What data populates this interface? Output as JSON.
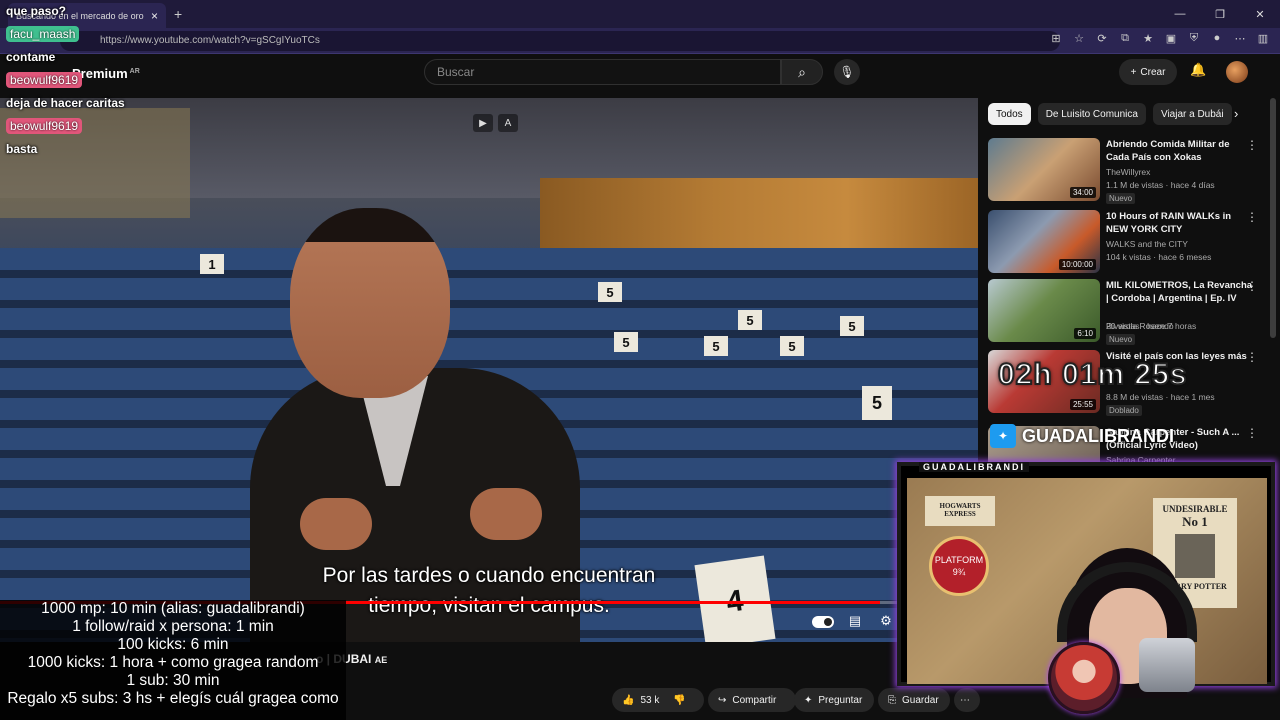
{
  "browser": {
    "tab_title": "Buscando en el mercado de oro",
    "url": "https://www.youtube.com/watch?v=gSCgIYuoTCs"
  },
  "youtube": {
    "logo_text": "Premium",
    "logo_country": "AR",
    "search_placeholder": "Buscar",
    "create_label": "Crear"
  },
  "video": {
    "subtitle_line1": "Por las tardes o cuando encuentran",
    "subtitle_line2": "tiempo, visitan el campus.",
    "title_visible": "o | DUBAI",
    "title_flag": "AE",
    "progress": 0.9,
    "seat_numbers": [
      "1",
      "5",
      "5",
      "5",
      "5",
      "5",
      "5",
      "5",
      "4"
    ]
  },
  "actions": {
    "likes": "53 k",
    "share": "Compartir",
    "ask": "Preguntar",
    "save": "Guardar"
  },
  "chips": [
    "Todos",
    "De Luisito Comunica",
    "Viajar a Dubái"
  ],
  "recommendations": [
    {
      "title": "Abriendo Comida Militar de Cada País con Xokas",
      "channel": "TheWillyrex",
      "meta": "1.1 M de vistas · hace 4 días",
      "duration": "34:00",
      "badge": "Nuevo"
    },
    {
      "title": "10 Hours of RAIN WALKs in NEW YORK CITY",
      "channel": "WALKS and the CITY",
      "meta": "104 k vistas · hace 6 meses",
      "duration": "10:00:00",
      "badge": ""
    },
    {
      "title": "MIL KILOMETROS, La Revancha | Cordoba | Argentina | Ep. IV",
      "channel": "Rivarola Rosendo",
      "meta": "20 vistas · hace 7 horas",
      "duration": "6:10",
      "badge": "Nuevo"
    },
    {
      "title": "Visité el país con las leyes más",
      "channel": "",
      "meta": "8.8 M de vistas · hace 1 mes",
      "duration": "25:55",
      "badge": "Doblado"
    },
    {
      "title": "Sabrina Carpenter - Such A ... (Official Lyric Video)",
      "channel": "Sabrina Carpenter",
      "meta": "",
      "duration": "",
      "badge": ""
    }
  ],
  "chat": [
    {
      "type": "msg",
      "text": "que paso?"
    },
    {
      "type": "nick",
      "text": "facu_maash",
      "color": "#3fbf8f"
    },
    {
      "type": "msg",
      "text": "contame"
    },
    {
      "type": "nick",
      "text": "beowulf9619",
      "color": "#e0567a"
    },
    {
      "type": "msg",
      "text": "deja de hacer caritas"
    },
    {
      "type": "nick",
      "text": "beowulf9619",
      "color": "#e0567a"
    },
    {
      "type": "msg",
      "text": "basta"
    }
  ],
  "stream": {
    "timer": "02h 01m 25s",
    "twitter_handle": "GUADALIBRANDI",
    "cam_label": "GUADALIBRANDI",
    "poster_title": "UNDESIRABLE",
    "poster_sub": "No 1",
    "poster_name": "HARRY POTTER",
    "platform_text": "PLATFORM 9¾",
    "hogwarts": "HOGWARTS EXPRESS"
  },
  "rules": [
    "1000 mp: 10 min (alias: guadalibrandi)",
    "1 follow/raid x persona: 1 min",
    "100 kicks: 6 min",
    "1000 kicks: 1 hora + como gragea random",
    "1 sub: 30 min",
    "Regalo x5 subs: 3 hs + elegís cuál gragea como"
  ]
}
